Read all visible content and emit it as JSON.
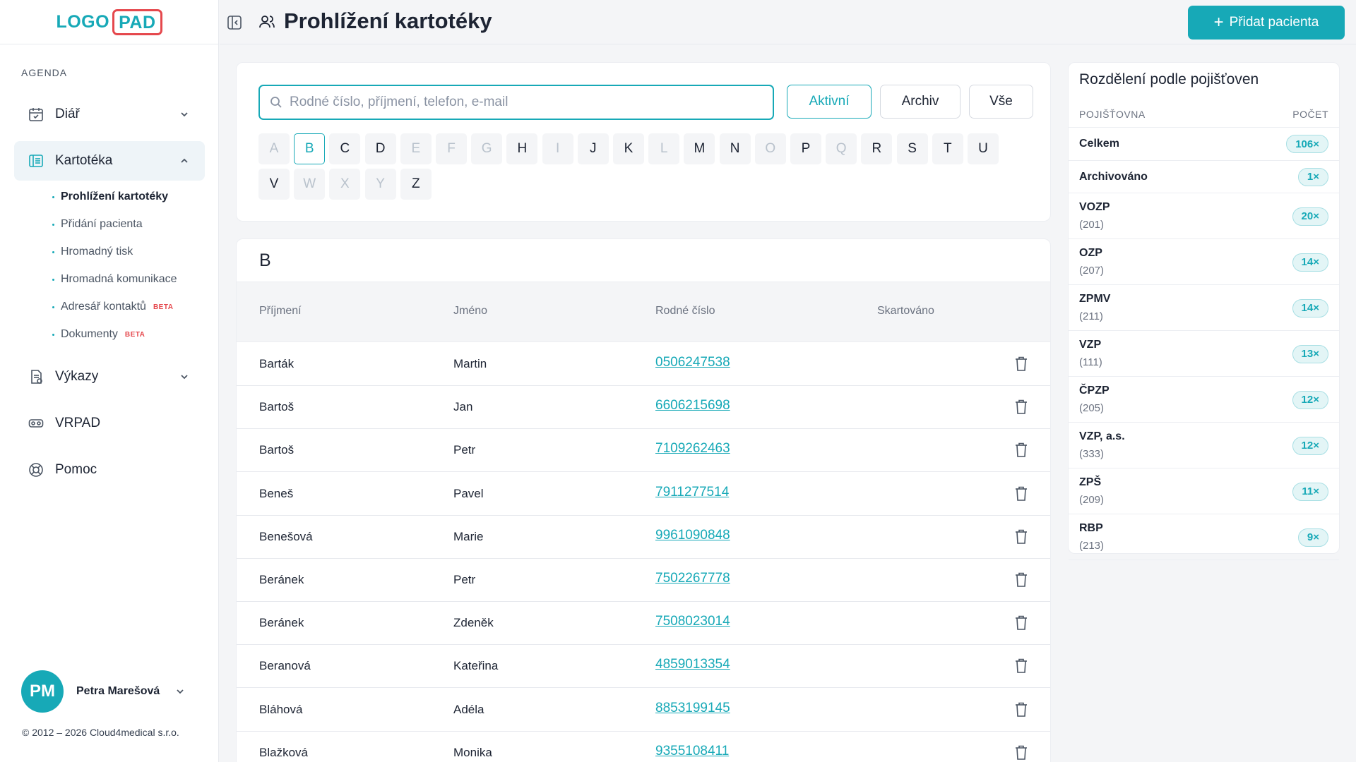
{
  "brand": {
    "logo_left": "LOGO",
    "logo_right": "PAD"
  },
  "sidebar": {
    "section_label": "AGENDA",
    "items": [
      {
        "label": "Diář",
        "icon": "calendar-icon"
      },
      {
        "label": "Kartotéka",
        "icon": "card-file-icon"
      },
      {
        "label": "Výkazy",
        "icon": "report-icon"
      },
      {
        "label": "VRPAD",
        "icon": "vr-headset-icon"
      },
      {
        "label": "Pomoc",
        "icon": "lifebuoy-icon"
      }
    ],
    "subitems": [
      {
        "label": "Prohlížení kartotéky",
        "badge": ""
      },
      {
        "label": "Přidání pacienta",
        "badge": ""
      },
      {
        "label": "Hromadný tisk",
        "badge": ""
      },
      {
        "label": "Hromadná komunikace",
        "badge": ""
      },
      {
        "label": "Adresář kontaktů",
        "badge": "BETA"
      },
      {
        "label": "Dokumenty",
        "badge": "BETA"
      }
    ],
    "user": {
      "initials": "PM",
      "name": "Petra Marešová"
    },
    "copyright": "© 2012 – 2026 Cloud4medical s.r.o."
  },
  "header": {
    "title": "Prohlížení kartotéky",
    "add_button": "Přidat pacienta"
  },
  "search": {
    "placeholder": "Rodné číslo, příjmení, telefon, e-mail",
    "value": "",
    "filters": [
      "Aktivní",
      "Archiv",
      "Vše"
    ],
    "active_filter": "Aktivní"
  },
  "alphabet": {
    "letters": [
      "A",
      "B",
      "C",
      "D",
      "E",
      "F",
      "G",
      "H",
      "I",
      "J",
      "K",
      "L",
      "M",
      "N",
      "O",
      "P",
      "Q",
      "R",
      "S",
      "T",
      "U",
      "V",
      "W",
      "X",
      "Y",
      "Z"
    ],
    "disabled": [
      "A",
      "E",
      "F",
      "G",
      "I",
      "L",
      "O",
      "Q",
      "W",
      "X",
      "Y"
    ],
    "selected": "B"
  },
  "patients": {
    "group": "B",
    "columns": [
      "Příjmení",
      "Jméno",
      "Rodné číslo",
      "Skartováno"
    ],
    "rows": [
      {
        "surname": "Barták",
        "first": "Martin",
        "rc": "0506247538"
      },
      {
        "surname": "Bartoš",
        "first": "Jan",
        "rc": "6606215698"
      },
      {
        "surname": "Bartoš",
        "first": "Petr",
        "rc": "7109262463"
      },
      {
        "surname": "Beneš",
        "first": "Pavel",
        "rc": "7911277514"
      },
      {
        "surname": "Benešová",
        "first": "Marie",
        "rc": "9961090848"
      },
      {
        "surname": "Beránek",
        "first": "Petr",
        "rc": "7502267778"
      },
      {
        "surname": "Beránek",
        "first": "Zdeněk",
        "rc": "7508023014"
      },
      {
        "surname": "Beranová",
        "first": "Kateřina",
        "rc": "4859013354"
      },
      {
        "surname": "Bláhová",
        "first": "Adéla",
        "rc": "8853199145"
      },
      {
        "surname": "Blažková",
        "first": "Monika",
        "rc": "9355108411"
      }
    ]
  },
  "insurance": {
    "title": "Rozdělení podle pojišťoven",
    "col_name": "POJIŠŤOVNA",
    "col_count": "POČET",
    "rows": [
      {
        "name": "Celkem",
        "code": "",
        "count": "106×"
      },
      {
        "name": "Archivováno",
        "code": "",
        "count": "1×"
      },
      {
        "name": "VOZP",
        "code": "(201)",
        "count": "20×"
      },
      {
        "name": "OZP",
        "code": "(207)",
        "count": "14×"
      },
      {
        "name": "ZPMV",
        "code": "(211)",
        "count": "14×"
      },
      {
        "name": "VZP",
        "code": "(111)",
        "count": "13×"
      },
      {
        "name": "ČPZP",
        "code": "(205)",
        "count": "12×"
      },
      {
        "name": "VZP, a.s.",
        "code": "(333)",
        "count": "12×"
      },
      {
        "name": "ZPŠ",
        "code": "(209)",
        "count": "11×"
      },
      {
        "name": "RBP",
        "code": "(213)",
        "count": "9×"
      }
    ]
  },
  "colors": {
    "accent": "#17a9b7",
    "logo_border": "#e5484d",
    "beta": "#e5484d"
  }
}
